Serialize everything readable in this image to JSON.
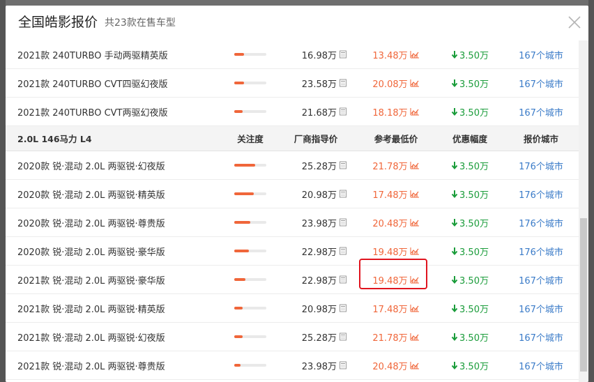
{
  "modal": {
    "title": "全国皓影报价",
    "subtitle": "共23款在售车型",
    "close_icon": "close-icon"
  },
  "table": {
    "top_rows": [
      {
        "name": "2021款 240TURBO 手动两驱精英版",
        "heat": 0.3,
        "msrp": "16.98万",
        "lowest": "13.48万",
        "discount": "3.50万",
        "cities": "167个城市"
      },
      {
        "name": "2021款 240TURBO CVT四驱幻夜版",
        "heat": 0.3,
        "msrp": "23.58万",
        "lowest": "20.08万",
        "discount": "3.50万",
        "cities": "167个城市"
      },
      {
        "name": "2021款 240TURBO CVT两驱幻夜版",
        "heat": 0.25,
        "msrp": "21.68万",
        "lowest": "18.18万",
        "discount": "3.50万",
        "cities": "167个城市"
      }
    ],
    "group": {
      "label": "2.0L 146马力 L4",
      "columns": [
        "关注度",
        "厂商指导价",
        "参考最低价",
        "优惠幅度",
        "报价城市"
      ]
    },
    "group_rows": [
      {
        "name": "2020款 锐·混动 2.0L 两驱锐·幻夜版",
        "heat": 0.65,
        "msrp": "25.28万",
        "lowest": "21.78万",
        "discount": "3.50万",
        "cities": "176个城市"
      },
      {
        "name": "2020款 锐·混动 2.0L 两驱锐·精英版",
        "heat": 0.6,
        "msrp": "20.98万",
        "lowest": "17.48万",
        "discount": "3.50万",
        "cities": "176个城市"
      },
      {
        "name": "2020款 锐·混动 2.0L 两驱锐·尊贵版",
        "heat": 0.5,
        "msrp": "23.98万",
        "lowest": "20.48万",
        "discount": "3.50万",
        "cities": "176个城市"
      },
      {
        "name": "2020款 锐·混动 2.0L 两驱锐·豪华版",
        "heat": 0.45,
        "msrp": "22.98万",
        "lowest": "19.48万",
        "discount": "3.50万",
        "cities": "176个城市"
      },
      {
        "name": "2021款 锐·混动 2.0L 两驱锐·豪华版",
        "heat": 0.35,
        "msrp": "22.98万",
        "lowest": "19.48万",
        "discount": "3.50万",
        "cities": "167个城市"
      },
      {
        "name": "2021款 锐·混动 2.0L 两驱锐·精英版",
        "heat": 0.25,
        "msrp": "20.98万",
        "lowest": "17.48万",
        "discount": "3.50万",
        "cities": "167个城市"
      },
      {
        "name": "2021款 锐·混动 2.0L 两驱锐·幻夜版",
        "heat": 0.25,
        "msrp": "25.28万",
        "lowest": "21.78万",
        "discount": "3.50万",
        "cities": "167个城市"
      },
      {
        "name": "2021款 锐·混动 2.0L 两驱锐·尊贵版",
        "heat": 0.2,
        "msrp": "23.98万",
        "lowest": "20.48万",
        "discount": "3.50万",
        "cities": "167个城市"
      }
    ]
  },
  "colors": {
    "accent_orange": "#f0663a",
    "discount_green": "#1a9c3a",
    "link_blue": "#3a7bc8",
    "highlight_red": "#e0141e"
  },
  "icons": {
    "msrp": "calculator-icon",
    "lowest": "trend-chart-icon",
    "discount": "arrow-down-icon"
  }
}
